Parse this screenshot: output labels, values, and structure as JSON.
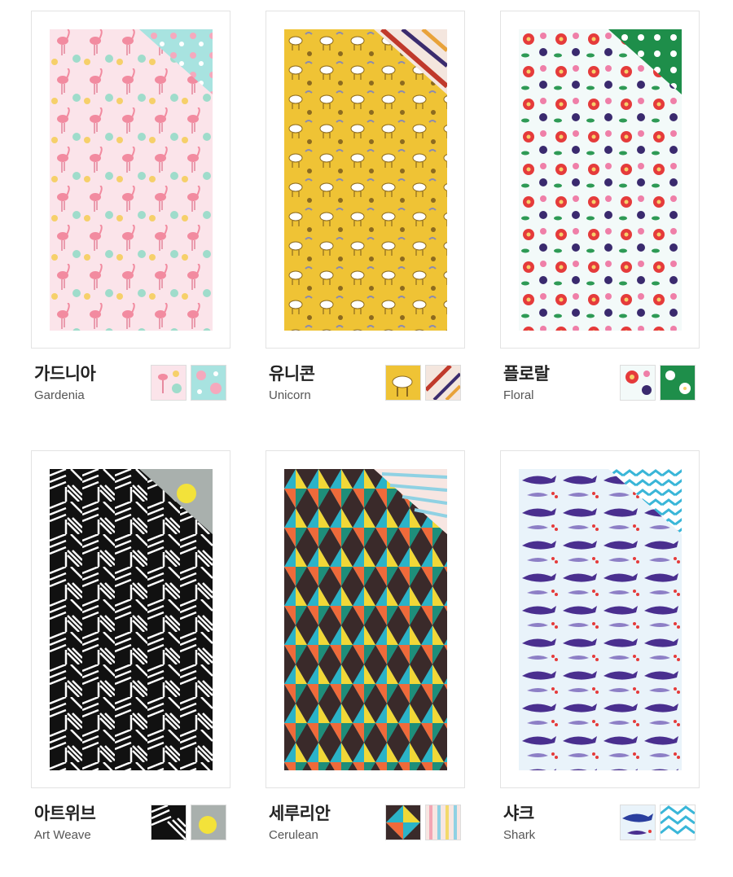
{
  "products": [
    {
      "id": "gardenia",
      "name_kr": "가드니아",
      "name_en": "Gardenia",
      "colors": {
        "base": "#f8dde3",
        "accent": "#f28ba0",
        "flap": "#a8e3e0"
      },
      "swatches": [
        {
          "icon": "flamingo-pattern-swatch"
        },
        {
          "icon": "floral-mint-swatch"
        }
      ]
    },
    {
      "id": "unicorn",
      "name_kr": "유니콘",
      "name_en": "Unicorn",
      "colors": {
        "base": "#efc335",
        "accent": "#8c6a1f",
        "flap": "#f4e6de"
      },
      "swatches": [
        {
          "icon": "unicorn-yellow-swatch"
        },
        {
          "icon": "leaf-stripe-swatch"
        }
      ]
    },
    {
      "id": "floral",
      "name_kr": "플로랄",
      "name_en": "Floral",
      "colors": {
        "base": "#f3faf9",
        "accent": "#e53b3b",
        "flap": "#1e8e4a"
      },
      "swatches": [
        {
          "icon": "floral-white-swatch"
        },
        {
          "icon": "floral-green-swatch"
        }
      ]
    },
    {
      "id": "art-weave",
      "name_kr": "아트위브",
      "name_en": "Art Weave",
      "colors": {
        "base": "#111111",
        "accent": "#ffffff",
        "flap": "#a9b0ad"
      },
      "swatches": [
        {
          "icon": "weave-bw-swatch"
        },
        {
          "icon": "sun-yellow-swatch"
        }
      ]
    },
    {
      "id": "cerulean",
      "name_kr": "세루리안",
      "name_en": "Cerulean",
      "colors": {
        "base": "#3a2a2a",
        "accent": "#2bb3c8",
        "flap": "#f7e6e2"
      },
      "swatches": [
        {
          "icon": "diamond-swatch"
        },
        {
          "icon": "stripe-pastel-swatch"
        }
      ]
    },
    {
      "id": "shark",
      "name_kr": "샤크",
      "name_en": "Shark",
      "colors": {
        "base": "#e9f3fa",
        "accent": "#4a2f8f",
        "flap": "#3ab6d8"
      },
      "swatches": [
        {
          "icon": "shark-swatch"
        },
        {
          "icon": "chevron-blue-swatch"
        }
      ]
    }
  ]
}
